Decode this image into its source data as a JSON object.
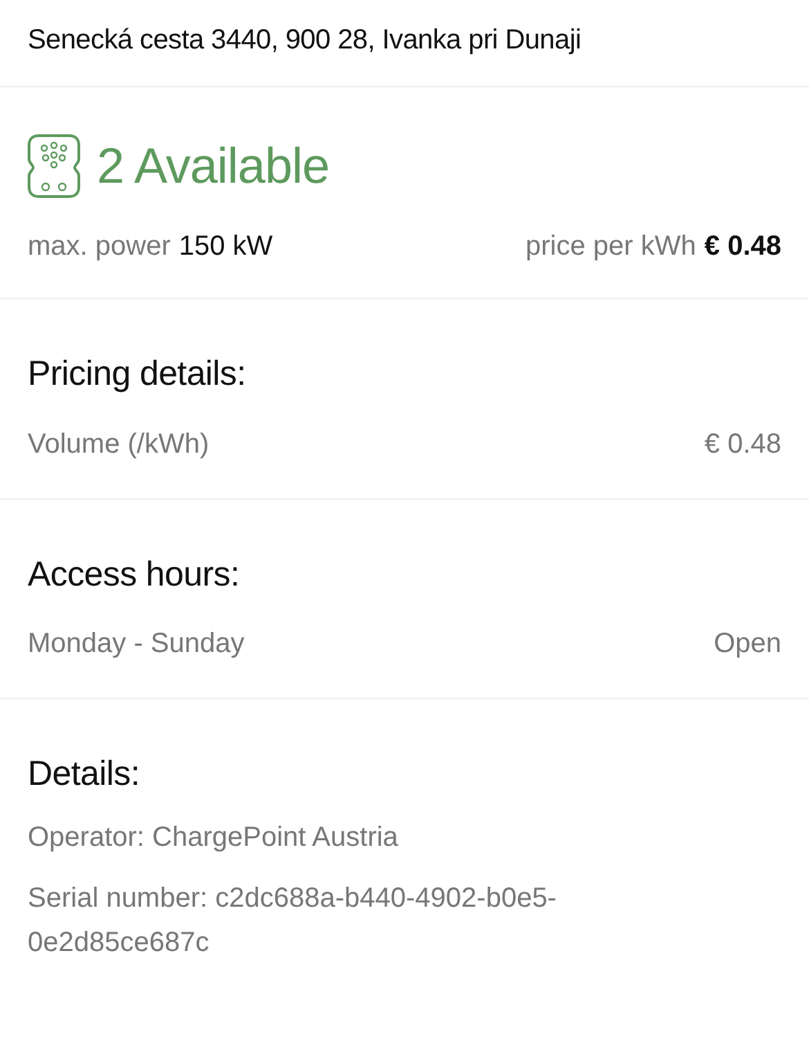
{
  "address": "Senecká cesta 3440, 900 28, Ivanka pri Dunaji",
  "availability": {
    "text": "2 Available",
    "color": "#5e9a5e"
  },
  "max_power": {
    "label": "max. power",
    "value": "150 kW"
  },
  "price": {
    "label": "price per kWh",
    "value": "€ 0.48"
  },
  "sections": [
    {
      "title": "Pricing details:",
      "kind": "pairs",
      "rows": [
        {
          "label": "Volume (/kWh)",
          "value": "€ 0.48"
        }
      ]
    },
    {
      "title": "Access hours:",
      "kind": "pairs",
      "rows": [
        {
          "label": "Monday - Sunday",
          "value": "Open"
        }
      ]
    },
    {
      "title": "Details:",
      "kind": "lines",
      "lines": [
        "Operator: ChargePoint Austria",
        "Serial number: c2dc688a-b440-4902-b0e5-0e2d85ce687c"
      ]
    }
  ]
}
